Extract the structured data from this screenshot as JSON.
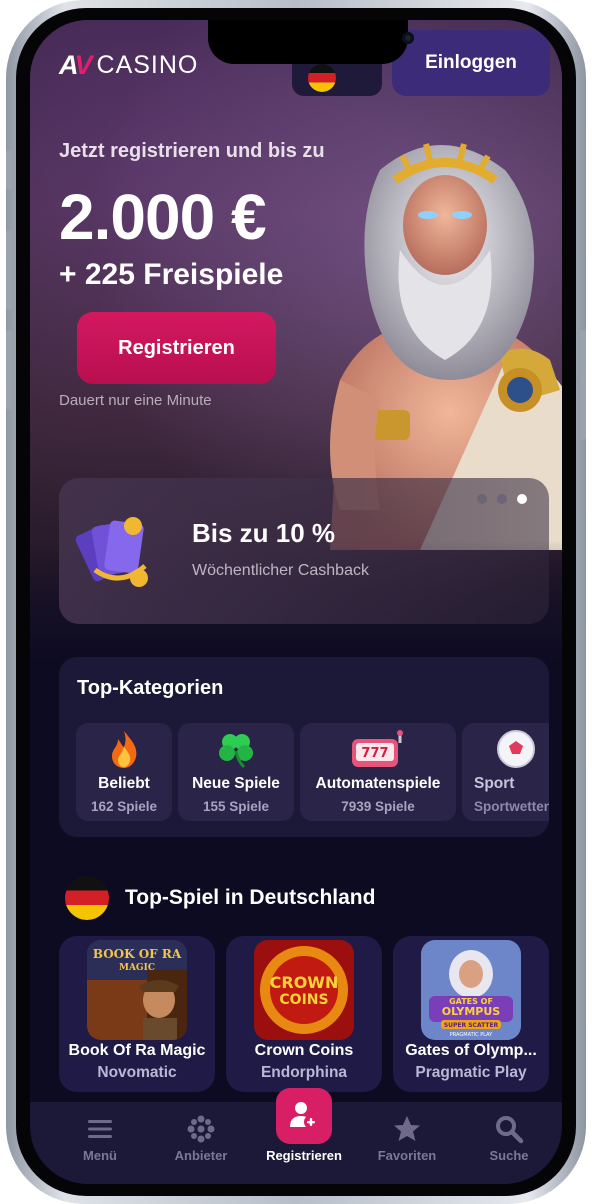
{
  "header": {
    "logo_mark": "AV",
    "logo_text": "CASINO",
    "login_label": "Einloggen",
    "language_flag_icon": "germany-flag-icon"
  },
  "hero": {
    "subtitle": "Jetzt registrieren und bis zu",
    "amount": "2.000 €",
    "spins": "+ 225 Freispiele",
    "cta_label": "Registrieren",
    "note": "Dauert nur eine Minute"
  },
  "promo": {
    "title": "Bis zu 10 %",
    "subtitle": "Wöchentlicher Cashback",
    "slides_total": 3,
    "active_slide": 3
  },
  "categories": {
    "title": "Top-Kategorien",
    "items": [
      {
        "label": "Beliebt",
        "count": "162 Spiele",
        "icon": "fire-icon"
      },
      {
        "label": "Neue Spiele",
        "count": "155 Spiele",
        "icon": "clover-icon"
      },
      {
        "label": "Automatenspiele",
        "count": "7939 Spiele",
        "icon": "slot-machine-icon"
      },
      {
        "label": "Sport",
        "count": "Sportwetten",
        "icon": "soccer-ball-icon"
      }
    ]
  },
  "top_games": {
    "title": "Top-Spiel in Deutschland",
    "items": [
      {
        "name": "Book Of Ra Magic",
        "provider": "Novomatic"
      },
      {
        "name": "Crown Coins",
        "provider": "Endorphina"
      },
      {
        "name": "Gates of Olymp...",
        "provider": "Pragmatic Play"
      }
    ],
    "art_text": [
      "BOOK OF RA",
      "MAGIC",
      "CROWN",
      "COINS",
      "GATES OF",
      "OLYMPUS",
      "SUPER SCATTER",
      "PRAGMATIC PLAY"
    ]
  },
  "nav": {
    "items": [
      {
        "label": "Menü",
        "icon": "menu-icon"
      },
      {
        "label": "Anbieter",
        "icon": "providers-icon"
      },
      {
        "label": "Registrieren",
        "icon": "add-user-icon"
      },
      {
        "label": "Favoriten",
        "icon": "star-icon"
      },
      {
        "label": "Suche",
        "icon": "search-icon"
      }
    ]
  },
  "colors": {
    "accent": "#d81e64",
    "login": "#3b2b78",
    "background": "#0d0b22",
    "card": "#1c1838"
  }
}
